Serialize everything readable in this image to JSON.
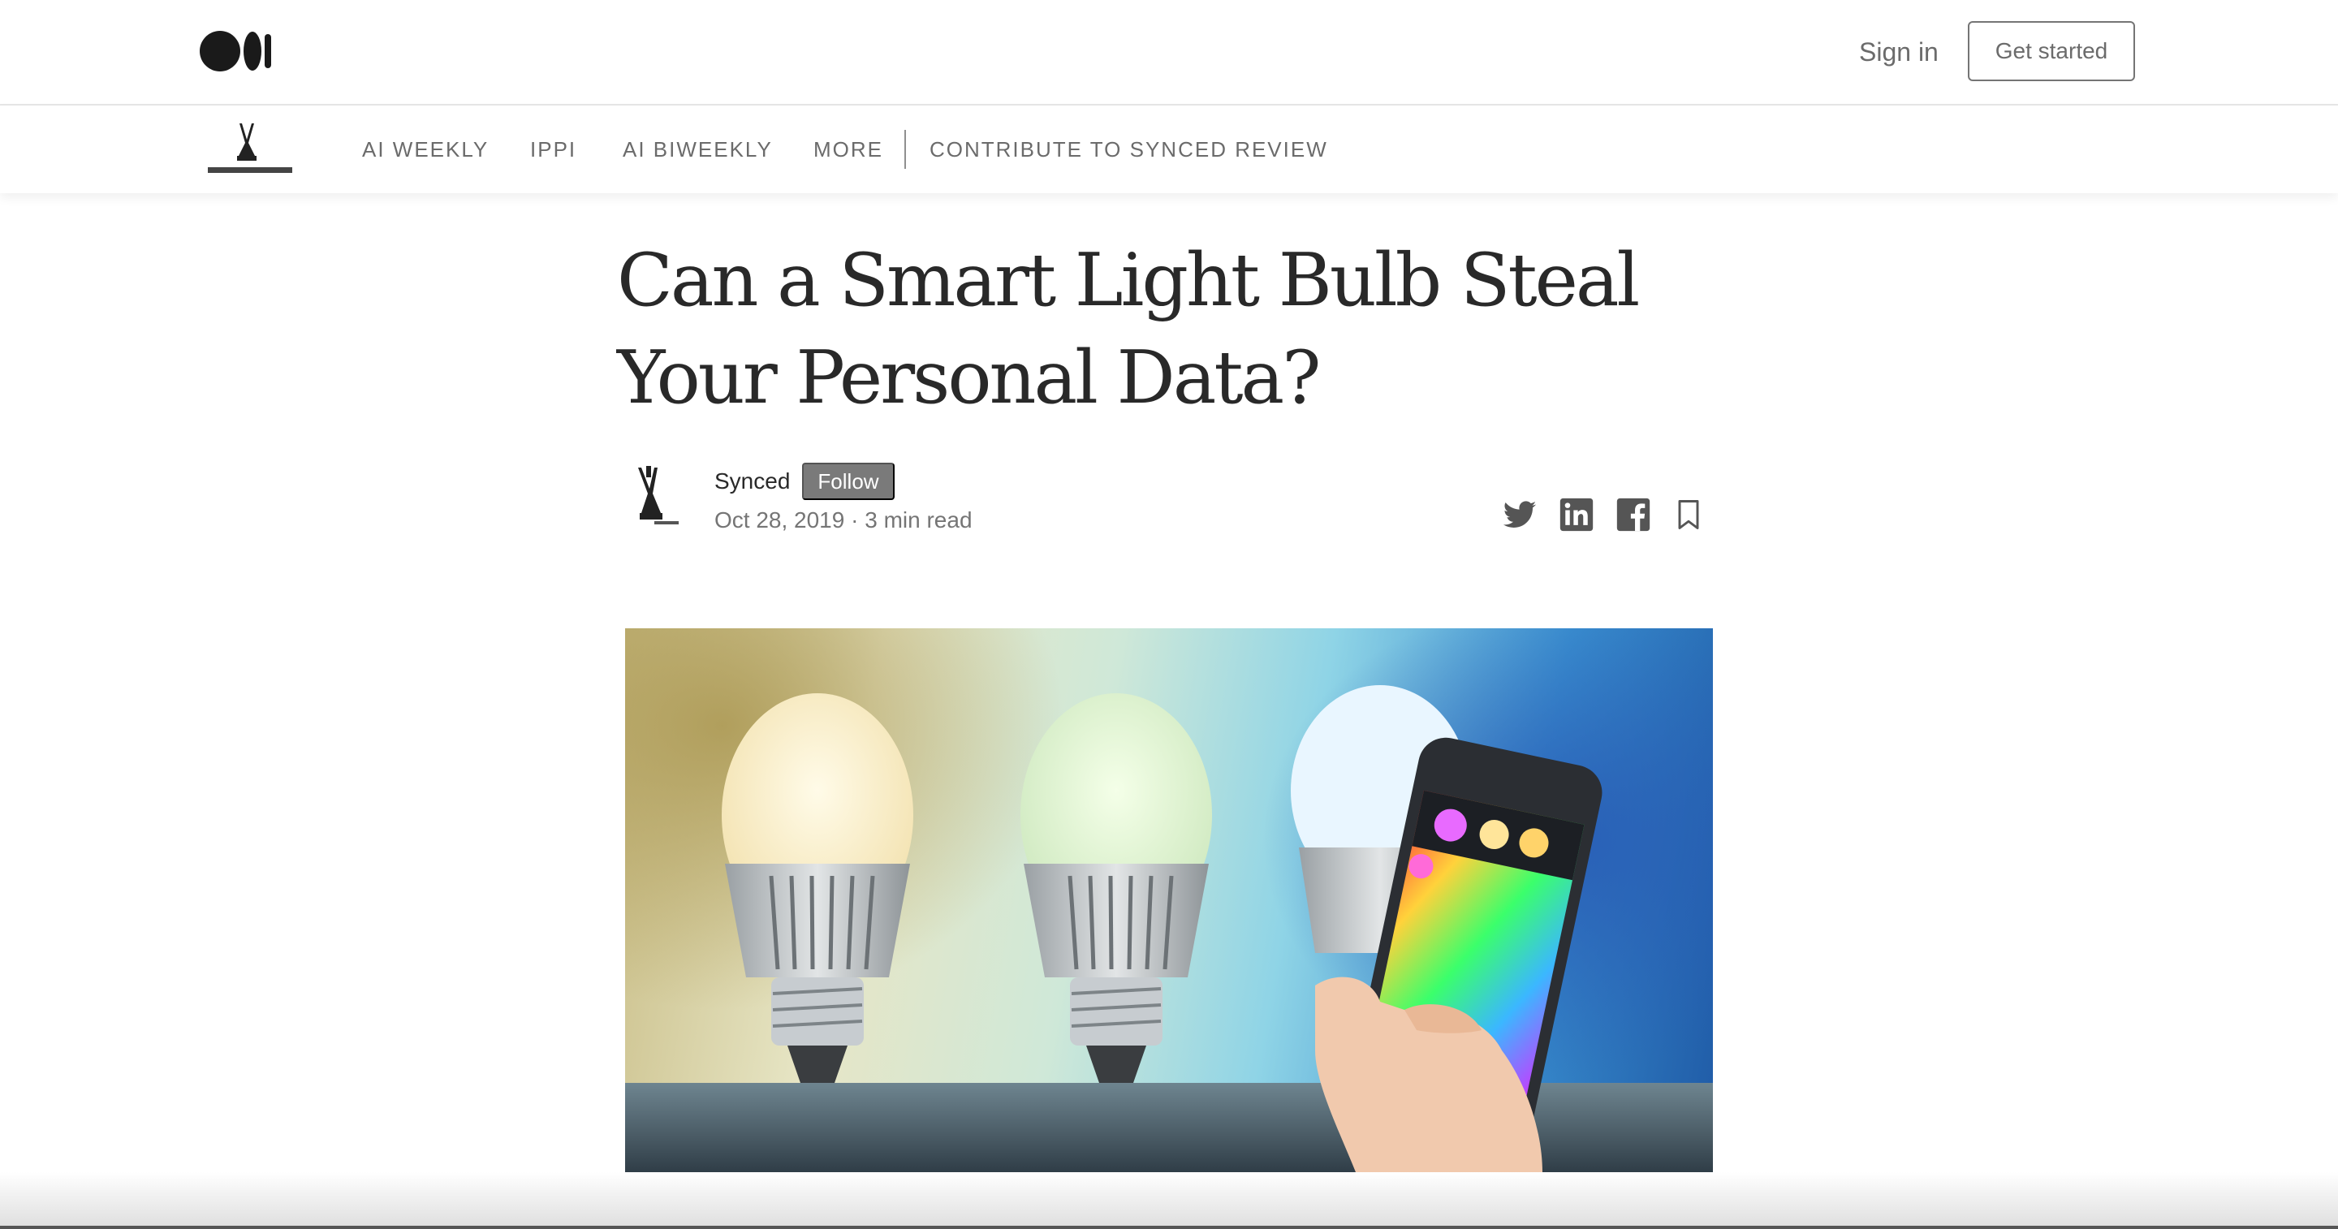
{
  "header": {
    "logo_icon": "medium-logo",
    "sign_in_label": "Sign in",
    "get_started_label": "Get started"
  },
  "publication_nav": {
    "logo_icon": "synced-logo",
    "items": [
      {
        "label": "AI WEEKLY"
      },
      {
        "label": "IPPI"
      },
      {
        "label": "AI BIWEEKLY"
      },
      {
        "label": "MORE"
      },
      {
        "label": "CONTRIBUTE TO SYNCED REVIEW"
      }
    ]
  },
  "article": {
    "title_line1": "Can a Smart Light Bulb Steal",
    "title_line2": "Your Personal Data?",
    "author": "Synced",
    "follow_label": "Follow",
    "date": "Oct 28, 2019",
    "separator": " · ",
    "read_time": "3 min read",
    "share_icons": [
      "twitter-icon",
      "linkedin-icon",
      "facebook-icon",
      "bookmark-icon"
    ],
    "hero_image": "smart-light-bulbs-with-phone-photo"
  },
  "colors": {
    "text_primary": "#292929",
    "text_secondary": "#757575",
    "follow_bg": "#7a7a7a"
  }
}
